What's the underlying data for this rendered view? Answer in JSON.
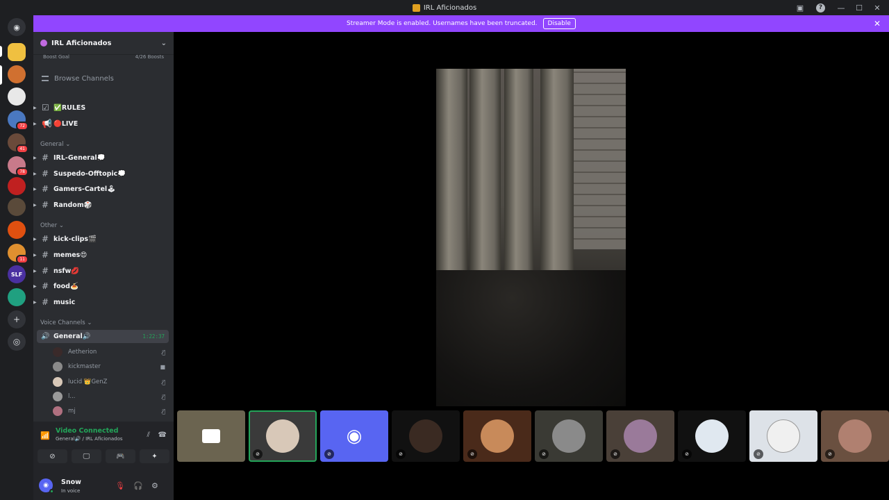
{
  "window": {
    "title": "IRL Aficionados",
    "minimize": "—",
    "maximize": "☐",
    "close": "✕",
    "help": "?"
  },
  "banner": {
    "text": "Streamer Mode is enabled. Usernames have been truncated.",
    "button": "Disable",
    "close": "✕"
  },
  "guilds": {
    "badges": [
      "72",
      "41",
      "78",
      "11"
    ],
    "labels": [
      "SLF"
    ]
  },
  "server": {
    "name": "IRL Aficionados",
    "boost_label": "Boost Goal",
    "boost_count": "4/26 Boosts",
    "browse": "Browse Channels"
  },
  "channels": {
    "top": [
      {
        "name": "✅RULES",
        "icon": "☑"
      },
      {
        "name": "🔴LIVE",
        "icon": "📢"
      }
    ],
    "categories": {
      "general": "General",
      "other": "Other",
      "voice": "Voice Channels"
    },
    "general": [
      "IRL-General💭",
      "Suspedo-Offtopic💭",
      "Gamers-Cartel🕹",
      "Random🎲"
    ],
    "other": [
      "kick-clips🎬",
      "memes😍",
      "nsfw💋",
      "food🍝",
      "music"
    ]
  },
  "voice": {
    "channel": "General🔊",
    "time": "1:22:37",
    "users": [
      {
        "name": "Aetherion",
        "status": "muted"
      },
      {
        "name": "kickmaster",
        "status": "camera"
      },
      {
        "name": "lucid 👑GenZ",
        "status": "muted"
      },
      {
        "name": "l...",
        "status": "muted"
      },
      {
        "name": "mj",
        "status": "muted"
      }
    ]
  },
  "panel": {
    "connected": "Video Connected",
    "location": "General🔊 / IRL Aficionados",
    "username": "Snow",
    "user_status": "In voice"
  },
  "tiles": [
    {
      "kind": "camera",
      "color": "#6b6450"
    },
    {
      "kind": "avatar",
      "color": "#d8c8b8",
      "active": true
    },
    {
      "kind": "discord",
      "color": "#5865f2"
    },
    {
      "kind": "avatar",
      "color": "#3a2a22"
    },
    {
      "kind": "avatar",
      "color": "#c88a5a"
    },
    {
      "kind": "avatar",
      "color": "#8a8a8a"
    },
    {
      "kind": "avatar",
      "color": "#9a7a9a"
    },
    {
      "kind": "avatar",
      "color": "#e0e8f0"
    },
    {
      "kind": "avatar",
      "color": "#f0f0f0"
    },
    {
      "kind": "avatar",
      "color": "#b08070"
    }
  ]
}
